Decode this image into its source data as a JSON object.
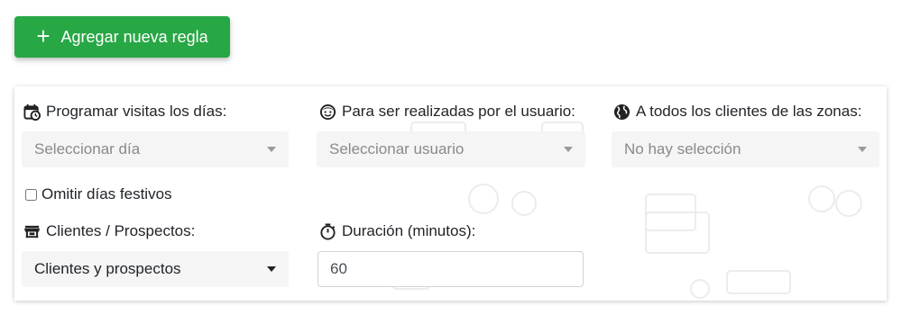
{
  "toolbar": {
    "add_rule_label": "Agregar nueva regla",
    "accent_color": "#28a745"
  },
  "form": {
    "schedule_days": {
      "label": "Programar visitas los días:",
      "icon": "calendar-clock-icon",
      "placeholder": "Seleccionar día"
    },
    "assigned_user": {
      "label": "Para ser realizadas por el usuario:",
      "icon": "smiley-face-icon",
      "placeholder": "Seleccionar usuario"
    },
    "zones": {
      "label": "A todos los clientes de las zonas:",
      "icon": "globe-icon",
      "placeholder": "No hay selección"
    },
    "skip_holidays": {
      "label": "Omitir días festivos",
      "checked": false
    },
    "client_type": {
      "label": "Clientes / Prospectos:",
      "icon": "store-icon",
      "selected": "Clientes y prospectos"
    },
    "duration": {
      "label": "Duración (minutos):",
      "icon": "stopwatch-icon",
      "value": "60"
    }
  }
}
